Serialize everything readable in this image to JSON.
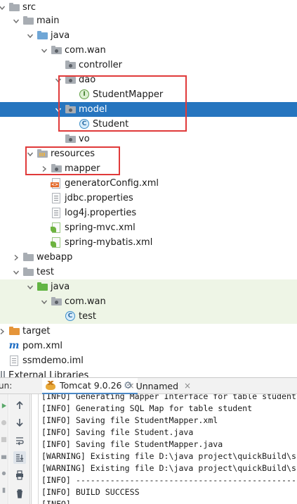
{
  "project_tree": {
    "items": [
      {
        "label": "src",
        "arrow": "down",
        "icon": "folder-gray"
      },
      {
        "label": "main",
        "arrow": "down",
        "icon": "folder-gray"
      },
      {
        "label": "java",
        "arrow": "down",
        "icon": "folder-blue"
      },
      {
        "label": "com.wan",
        "arrow": "down",
        "icon": "package"
      },
      {
        "label": "controller",
        "arrow": "",
        "icon": "package"
      },
      {
        "label": "dao",
        "arrow": "down",
        "icon": "package"
      },
      {
        "label": "StudentMapper",
        "arrow": "",
        "icon": "interface",
        "badge": "I"
      },
      {
        "label": "model",
        "arrow": "down",
        "icon": "package",
        "selected": true
      },
      {
        "label": "Student",
        "arrow": "",
        "icon": "class",
        "badge": "C"
      },
      {
        "label": "vo",
        "arrow": "",
        "icon": "package"
      },
      {
        "label": "resources",
        "arrow": "down",
        "icon": "resources-folder"
      },
      {
        "label": "mapper",
        "arrow": "right",
        "icon": "package"
      },
      {
        "label": "generatorConfig.xml",
        "arrow": "",
        "icon": "xml-file"
      },
      {
        "label": "jdbc.properties",
        "arrow": "",
        "icon": "properties-file"
      },
      {
        "label": "log4j.properties",
        "arrow": "",
        "icon": "properties-file"
      },
      {
        "label": "spring-mvc.xml",
        "arrow": "",
        "icon": "spring-xml-file"
      },
      {
        "label": "spring-mybatis.xml",
        "arrow": "",
        "icon": "spring-xml-file"
      },
      {
        "label": "webapp",
        "arrow": "right",
        "icon": "folder-gray"
      },
      {
        "label": "test",
        "arrow": "down",
        "icon": "folder-gray"
      },
      {
        "label": "java",
        "arrow": "down",
        "icon": "folder-green"
      },
      {
        "label": "com.wan",
        "arrow": "down",
        "icon": "package"
      },
      {
        "label": "test",
        "arrow": "",
        "icon": "class",
        "badge": "C"
      },
      {
        "label": "target",
        "arrow": "right",
        "icon": "folder-orange"
      },
      {
        "label": "pom.xml",
        "arrow": "",
        "icon": "maven-file",
        "badge": "m"
      },
      {
        "label": "ssmdemo.iml",
        "arrow": "",
        "icon": "iml-file"
      },
      {
        "label": "External Libraries",
        "arrow": "",
        "icon": "libraries"
      }
    ]
  },
  "run_panel": {
    "label": "un:",
    "tabs": [
      {
        "label": "Tomcat 9.0.26",
        "icon": "tomcat-icon",
        "active": true
      },
      {
        "label": "Unnamed",
        "icon": "gear-icon",
        "active": false
      }
    ],
    "close_glyph": "×"
  },
  "console": {
    "lines": [
      "[INFO] Generating Mapper Interface for table student",
      "[INFO] Generating SQL Map for table student",
      "[INFO] Saving file StudentMapper.xml",
      "[INFO] Saving file Student.java",
      "[INFO] Saving file StudentMapper.java",
      "[WARNING] Existing file D:\\java project\\quickBuild\\ss",
      "[WARNING] Existing file D:\\java project\\quickBuild\\ss",
      "[INFO] ------------------------------------------------",
      "[INFO] BUILD SUCCESS",
      "[INFO] ------------------------------------------------"
    ]
  },
  "colors": {
    "selection": "#2675bf",
    "highlight_box": "#e03a3a",
    "test_background": "#eef5e6"
  }
}
